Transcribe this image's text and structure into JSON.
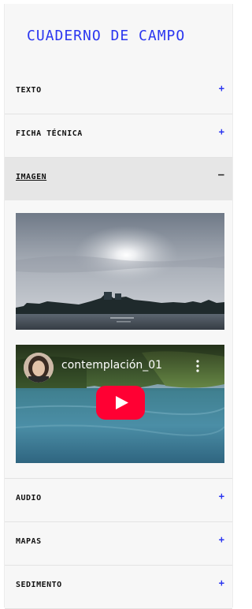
{
  "header": {
    "title": "CUADERNO DE CAMPO"
  },
  "sections": [
    {
      "label": "TEXTO",
      "sign": "+"
    },
    {
      "label": "FICHA TÉCNICA",
      "sign": "+"
    },
    {
      "label": "IMAGEN",
      "sign": "−"
    },
    {
      "label": "AUDIO",
      "sign": "+"
    },
    {
      "label": "MAPAS",
      "sign": "+"
    },
    {
      "label": "SEDIMENTO",
      "sign": "+"
    }
  ],
  "media": {
    "video": {
      "title": "contemplación_01"
    }
  },
  "colors": {
    "accent": "#2b36f0",
    "youtube_red": "#ff0033"
  }
}
